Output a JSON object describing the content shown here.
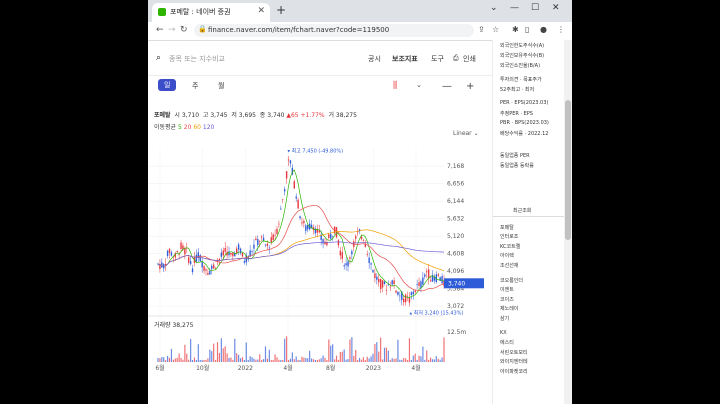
{
  "browser": {
    "tab_title": "포메탈 : 네이버 증권",
    "url": "finance.naver.com/item/fchart.naver?code=119500"
  },
  "toolbar": {
    "search_placeholder": "종목 또는 지수비교",
    "disclosure": "공시",
    "indicators": "보조지표",
    "tools": "도구",
    "print": "인쇄"
  },
  "periods": [
    "일",
    "주",
    "월"
  ],
  "stock": {
    "name": "포메탈",
    "open_label": "시",
    "open": "3,710",
    "high_label": "고",
    "high": "3,745",
    "low_label": "저",
    "low": "3,695",
    "close_label": "종",
    "close": "3,740",
    "change": "▲65",
    "change_pct": "+1.77%",
    "volume_label": "거",
    "volume": "38,275",
    "ma_label": "이동평균",
    "ma5": "5",
    "ma20": "20",
    "ma60": "60",
    "ma120": "120",
    "scale_mode": "Linear"
  },
  "chart_data": {
    "type": "line",
    "title": "",
    "x_ticks": [
      "6월",
      "10월",
      "2022",
      "4월",
      "8월",
      "2023",
      "4월"
    ],
    "y_ticks": [
      7168,
      6656,
      6144,
      5632,
      5120,
      4608,
      4096,
      3584,
      3072
    ],
    "ylim": [
      2900,
      7700
    ],
    "max_annotation": "최고 7,450 (-49.80%)",
    "min_annotation": "최저 3,240 (15.43%)",
    "current_price_tag": "3,740",
    "volume_label": "거래량 38,275",
    "volume_scale": "12.5m",
    "colors": {
      "up": "#e8373b",
      "down": "#2e5bd8",
      "ma5": "#2db400",
      "ma20": "#e94b4b",
      "ma60": "#f0a000",
      "ma120": "#6b5bd6",
      "price_tag_bg": "#2e5bd8"
    },
    "series": [
      {
        "x": [
          0,
          6,
          12,
          18,
          24,
          30,
          36,
          42,
          48,
          54,
          60,
          66,
          72,
          78,
          84,
          90,
          96,
          102,
          108,
          114,
          120,
          126,
          132,
          138,
          144,
          150,
          156,
          162,
          168,
          174,
          180,
          186,
          192,
          198,
          204,
          210,
          216,
          222,
          228,
          234,
          240,
          246,
          252,
          258,
          264,
          270,
          276,
          282,
          288,
          294,
          300
        ],
        "values": [
          4300,
          4250,
          4700,
          4500,
          4800,
          4650,
          4200,
          4600,
          4250,
          4100,
          4300,
          4500,
          4700,
          4450,
          4850,
          4400,
          4600,
          4900,
          5050,
          4800,
          5000,
          5400,
          6400,
          7450,
          6500,
          5600,
          5300,
          5500,
          5200,
          4900,
          5050,
          5400,
          4600,
          4200,
          4800,
          5200,
          5100,
          4400,
          3950,
          3700,
          3650,
          3800,
          3450,
          3300,
          3240,
          3600,
          3700,
          4100,
          3850,
          3950,
          3740
        ]
      }
    ]
  },
  "right_panel": {
    "items_top": [
      "외국인한도주식수(A)",
      "외국인보유주식수(B)",
      "외국인소진율(B/A)",
      "투자의견 · 목표주가",
      "52주최고 · 최저",
      "PER · EPS(2023.03)",
      "추정PER · EPS",
      "PBR · BPS(2023.03)",
      "배당수익률 · 2022.12",
      "동일업종 PER",
      "동일업종 등락률"
    ],
    "recent_header": "최근조회",
    "recent_items": [
      "포메탈",
      "인터로조",
      "KC코트렐",
      "아이렉",
      "조선선재",
      "코오롱인더",
      "이엔트",
      "코이즈",
      "제노레이",
      "삼기",
      "KX",
      "에스티",
      "서린오토모티",
      "와이지엔터테",
      "아이파켓코리"
    ]
  }
}
